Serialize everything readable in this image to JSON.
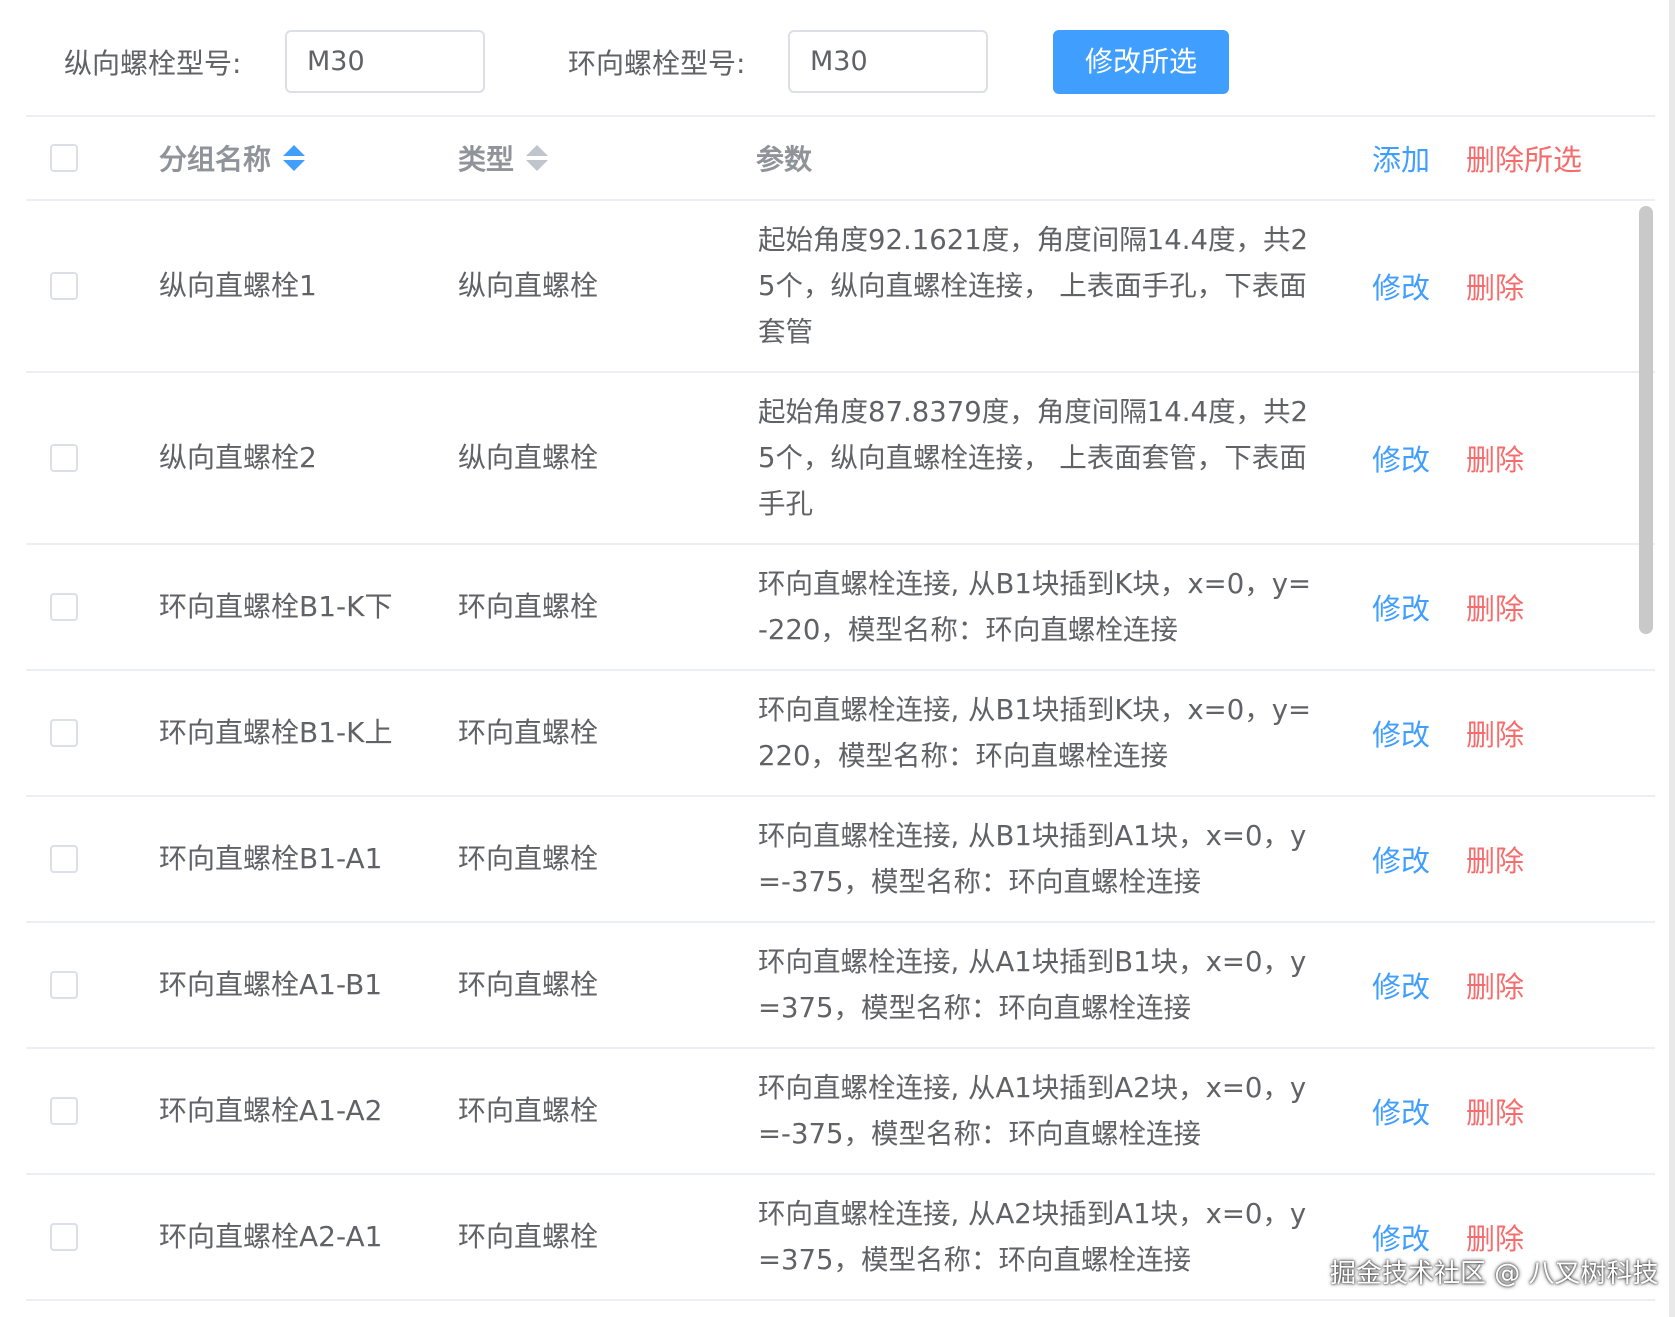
{
  "toolbar": {
    "longitudinal_label": "纵向螺栓型号:",
    "longitudinal_value": "M30",
    "circumferential_label": "环向螺栓型号:",
    "circumferential_value": "M30",
    "modify_selected_button": "修改所选"
  },
  "table": {
    "columns": {
      "name": "分组名称",
      "type": "类型",
      "params": "参数",
      "add": "添加",
      "delete_selected": "删除所选"
    },
    "name_sort_active": true,
    "action_edit": "修改",
    "action_delete": "删除",
    "rows": [
      {
        "name": "纵向直螺栓1",
        "type": "纵向直螺栓",
        "params": "起始角度92.1621度，角度间隔14.4度，共25个，纵向直螺栓连接， 上表面手孔，下表面套管"
      },
      {
        "name": "纵向直螺栓2",
        "type": "纵向直螺栓",
        "params": "起始角度87.8379度，角度间隔14.4度，共25个，纵向直螺栓连接， 上表面套管，下表面手孔"
      },
      {
        "name": "环向直螺栓B1-K下",
        "type": "环向直螺栓",
        "params": "环向直螺栓连接, 从B1块插到K块，x=0，y=-220，模型名称：环向直螺栓连接"
      },
      {
        "name": "环向直螺栓B1-K上",
        "type": "环向直螺栓",
        "params": "环向直螺栓连接, 从B1块插到K块，x=0，y=220，模型名称：环向直螺栓连接"
      },
      {
        "name": "环向直螺栓B1-A1",
        "type": "环向直螺栓",
        "params": "环向直螺栓连接, 从B1块插到A1块，x=0，y=-375，模型名称：环向直螺栓连接"
      },
      {
        "name": "环向直螺栓A1-B1",
        "type": "环向直螺栓",
        "params": "环向直螺栓连接, 从A1块插到B1块，x=0，y=375，模型名称：环向直螺栓连接"
      },
      {
        "name": "环向直螺栓A1-A2",
        "type": "环向直螺栓",
        "params": "环向直螺栓连接, 从A1块插到A2块，x=0，y=-375，模型名称：环向直螺栓连接"
      },
      {
        "name": "环向直螺栓A2-A1",
        "type": "环向直螺栓",
        "params": "环向直螺栓连接, 从A2块插到A1块，x=0，y=375，模型名称：环向直螺栓连接"
      }
    ]
  },
  "watermark": "掘金技术社区 @ 八叉树科技",
  "colors": {
    "primary": "#409eff",
    "danger": "#f56c6c",
    "text": "#606266",
    "header_text": "#909399",
    "border": "#ebeef5"
  }
}
